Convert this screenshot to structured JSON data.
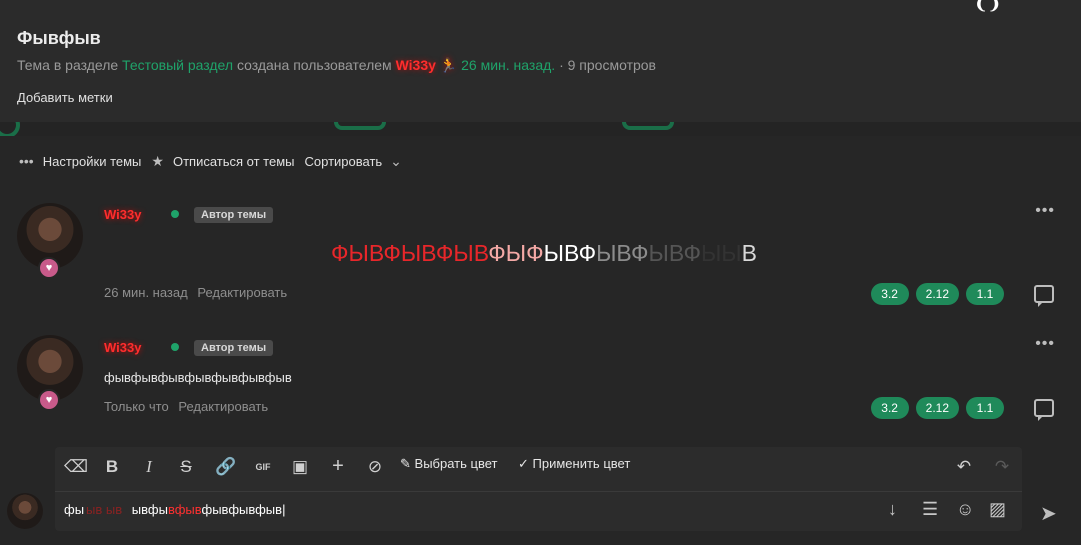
{
  "topic": {
    "title": "Фывфыв",
    "meta_prefix": "Тема в разделе",
    "section": "Тестовый раздел",
    "meta_mid": "создана пользователем",
    "author": "Wi33y",
    "time": "26 мин. назад.",
    "views": "· 9 просмотров",
    "add_tags": "Добавить метки"
  },
  "toolbar": {
    "settings": "Настройки темы",
    "unsubscribe": "Отписаться от темы",
    "sort": "Сортировать"
  },
  "posts": [
    {
      "author": "Wi33y",
      "badge": "Автор темы",
      "segments": [
        {
          "text": "ФЫВФЫВФЫВ",
          "color": "#e8262a"
        },
        {
          "text": "ФЫФ",
          "color": "#f4a9a6"
        },
        {
          "text": "ЫВФ",
          "color": "#ffffff"
        },
        {
          "text": "ЫВФ",
          "color": "#8c8c8c"
        },
        {
          "text": "ЫВФ",
          "color": "#555555"
        },
        {
          "text": "ЫЫ",
          "color": "#333333"
        },
        {
          "text": "В",
          "color": "#d8d8d8"
        }
      ],
      "time": "26 мин. назад",
      "edit": "Редактировать",
      "reactions": [
        "3.2",
        "2.12",
        "1.1"
      ]
    },
    {
      "author": "Wi33y",
      "badge": "Автор темы",
      "text": "фывфывфывфывфывфывфыв",
      "time": "Только что",
      "edit": "Редактировать",
      "reactions": [
        "3.2",
        "2.12",
        "1.1"
      ]
    }
  ],
  "editor": {
    "pick_color": "Выбрать цвет",
    "apply_color": "Применить цвет",
    "gif_label": "GIF",
    "text_a": "фы",
    "text_b": "ывфы",
    "text_c": "фыв",
    "text_d": "вфыв",
    "text_e": "фывфывфыв"
  },
  "colors": {
    "accent": "#1f8a5a",
    "author": "#ff2d2d",
    "link": "#1fa36a"
  }
}
